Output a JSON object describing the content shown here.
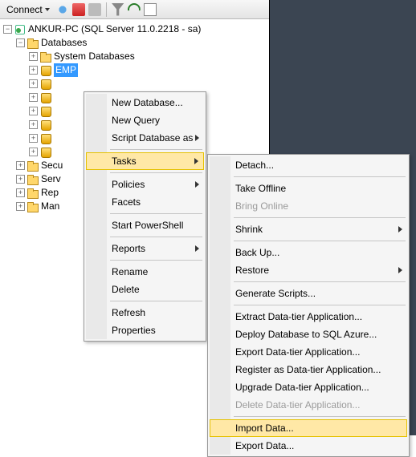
{
  "toolbar": {
    "connect": "Connect"
  },
  "tree": {
    "server": "ANKUR-PC (SQL Server 11.0.2218 - sa)",
    "databases": "Databases",
    "sysdb": "System Databases",
    "selected": "EMP",
    "secu": "Secu",
    "serv": "Serv",
    "rep": "Rep",
    "man": "Man"
  },
  "menu1": {
    "new_database": "New Database...",
    "new_query": "New Query",
    "script_as": "Script Database as",
    "tasks": "Tasks",
    "policies": "Policies",
    "facets": "Facets",
    "powershell": "Start PowerShell",
    "reports": "Reports",
    "rename": "Rename",
    "delete": "Delete",
    "refresh": "Refresh",
    "properties": "Properties"
  },
  "menu2": {
    "detach": "Detach...",
    "offline": "Take Offline",
    "online": "Bring Online",
    "shrink": "Shrink",
    "backup": "Back Up...",
    "restore": "Restore",
    "genscripts": "Generate Scripts...",
    "extract": "Extract Data-tier Application...",
    "deployazure": "Deploy Database to SQL Azure...",
    "exportdta": "Export Data-tier Application...",
    "register": "Register as Data-tier Application...",
    "upgrade": "Upgrade Data-tier Application...",
    "deletedta": "Delete Data-tier Application...",
    "importdata": "Import Data...",
    "exportdata": "Export Data..."
  }
}
